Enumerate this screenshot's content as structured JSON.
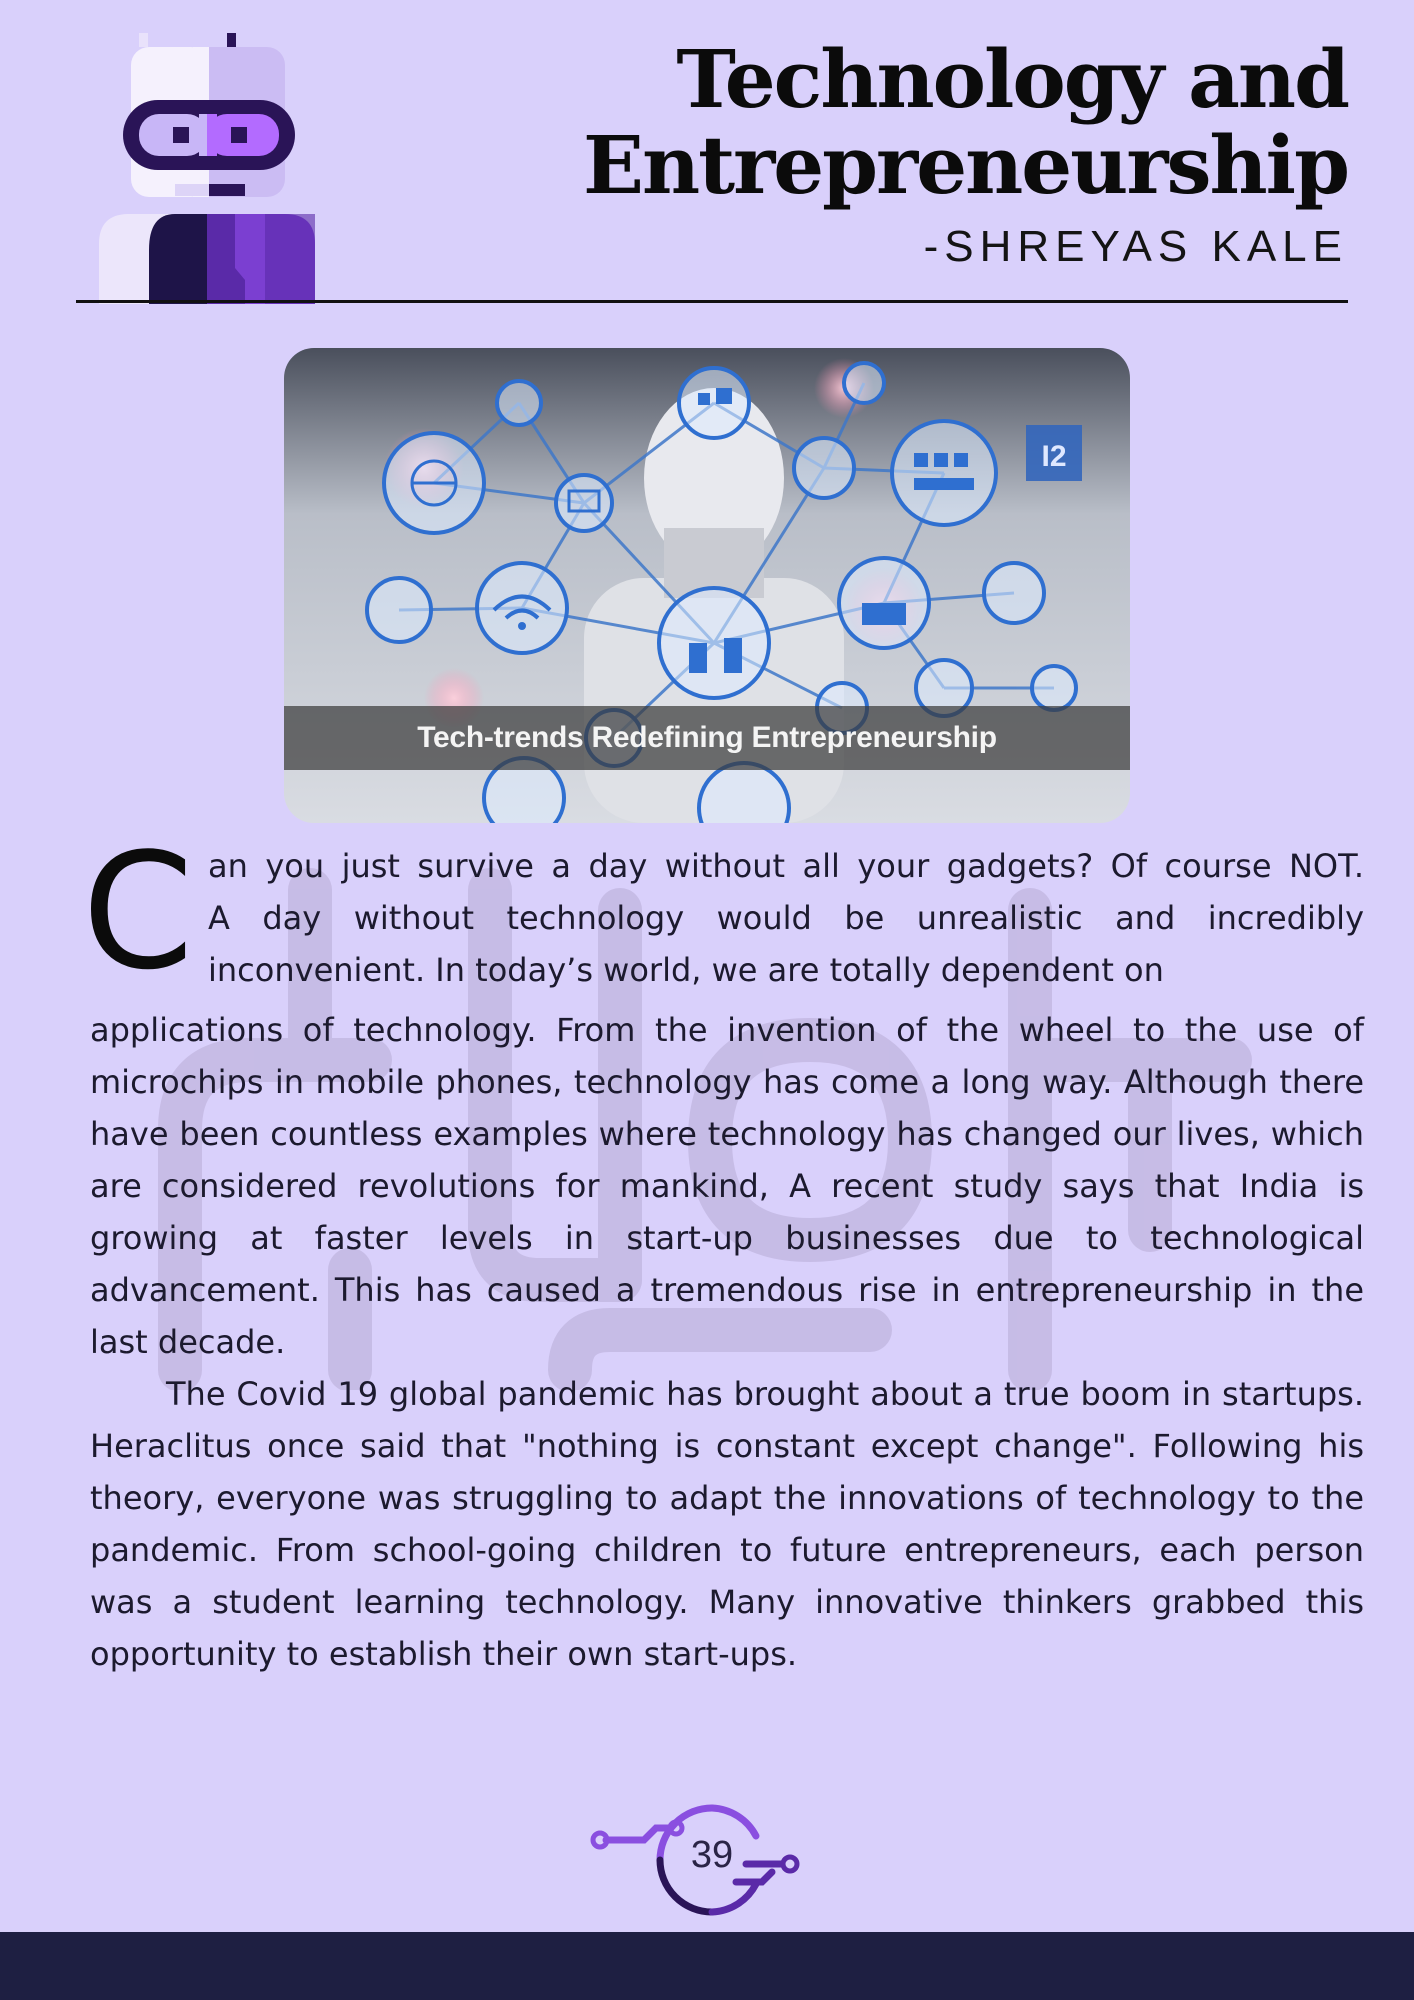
{
  "header": {
    "title_line_1": "Technology and",
    "title_line_2": "Entrepreneurship",
    "author": "-SHREYAS KALE"
  },
  "hero_image": {
    "caption": "Tech-trends Redefining Entrepreneurship",
    "badge_text": "I2"
  },
  "article": {
    "drop_cap": "C",
    "intro_lines": [
      "an you just survive a day without all your gadgets? Of course NOT.",
      "A day without technology would be unrealistic and incredibly",
      "inconvenient. In today’s world, we are totally dependent on"
    ],
    "paragraph_1": "applications of technology. From the invention of the wheel to the use of microchips in mobile phones, technology has come a long way. Although there have been countless examples where technology has changed our lives, which are considered revolutions for mankind, A recent study says that India is growing at faster levels in start-up businesses due to technological advancement. This has caused a tremendous rise in entrepreneurship in the last decade.",
    "paragraph_2": "The Covid 19 global pandemic has brought about a true boom in startups. Heraclitus once said that \"nothing is constant except change\". Following his theory, everyone was struggling to adapt the innovations of technology to the pandemic. From school-going children to future entrepreneurs, each person was a student learning technology. Many innovative thinkers grabbed this opportunity to establish their own start-ups."
  },
  "footer": {
    "page_number": "39"
  },
  "colors": {
    "page_background": "#d9d0fb",
    "footer_bar": "#1e1f42",
    "accent_purple": "#7b3fd1",
    "dark_purple": "#2a1457"
  }
}
